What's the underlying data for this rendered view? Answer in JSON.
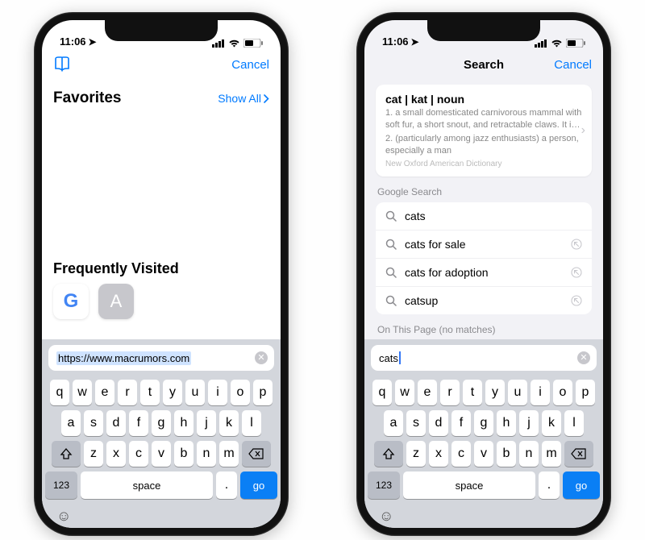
{
  "status": {
    "time": "11:06"
  },
  "left": {
    "cancel": "Cancel",
    "favorites_title": "Favorites",
    "show_all": "Show All",
    "freq_title": "Frequently Visited",
    "url_value": "https://www.macrumors.com",
    "fav2_letter": "A"
  },
  "right": {
    "title": "Search",
    "cancel": "Cancel",
    "dict_head": "cat | kat | noun",
    "dict_def1": "1. a small domesticated carnivorous mammal with soft fur, a short snout, and retractable claws. It i…",
    "dict_def2": "2. (particularly among jazz enthusiasts) a person, especially a man",
    "dict_src": "New Oxford American Dictionary",
    "google_label": "Google Search",
    "suggestions": [
      "cats",
      "cats for sale",
      "cats for adoption",
      "catsup"
    ],
    "on_page": "On This Page (no matches)",
    "search_value": "cats"
  },
  "keyboard": {
    "row1": [
      "q",
      "w",
      "e",
      "r",
      "t",
      "y",
      "u",
      "i",
      "o",
      "p"
    ],
    "row2": [
      "a",
      "s",
      "d",
      "f",
      "g",
      "h",
      "j",
      "k",
      "l"
    ],
    "row3": [
      "z",
      "x",
      "c",
      "v",
      "b",
      "n",
      "m"
    ],
    "num": "123",
    "space": "space",
    "period": ".",
    "go": "go"
  }
}
